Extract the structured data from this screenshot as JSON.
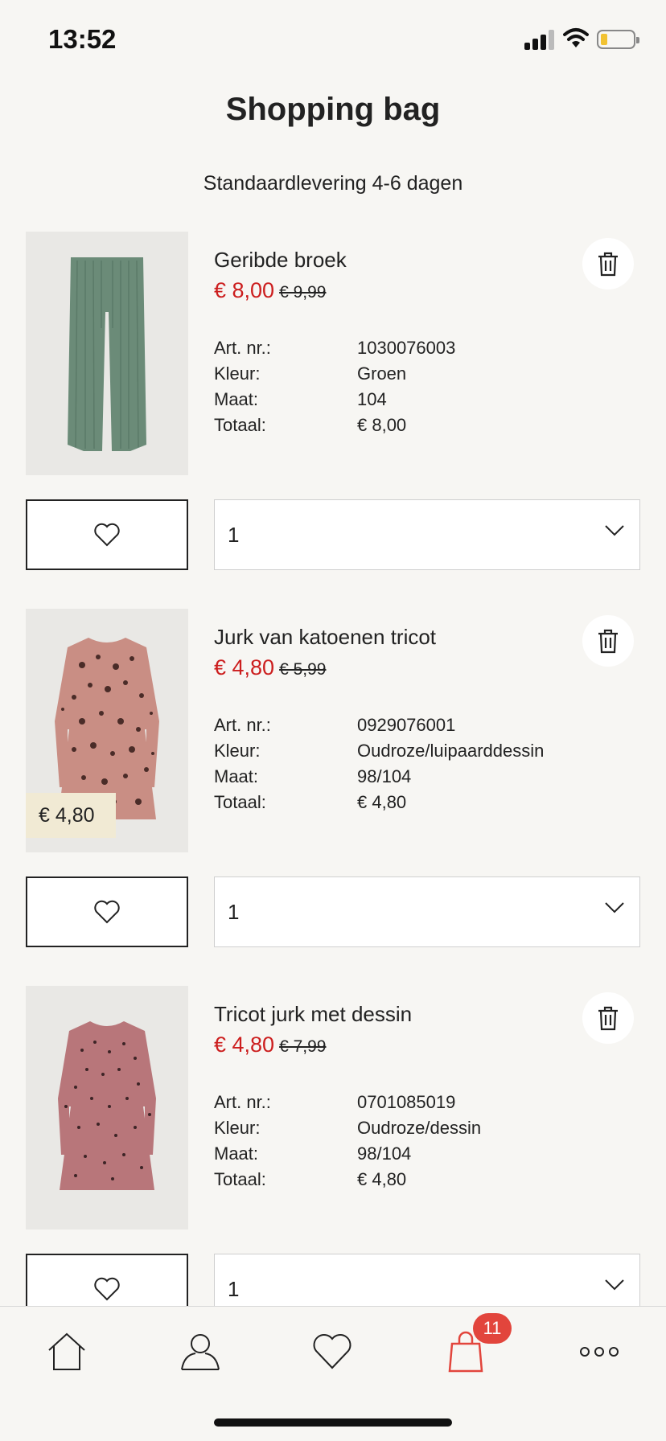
{
  "status_bar": {
    "time": "13:52"
  },
  "header": {
    "title": "Shopping bag",
    "delivery": "Standaardlevering 4-6 dagen"
  },
  "labels": {
    "art": "Art. nr.:",
    "color": "Kleur:",
    "size": "Maat:",
    "total": "Totaal:"
  },
  "items": [
    {
      "name": "Geribde broek",
      "price_sale": "€ 8,00",
      "price_old": "€ 9,99",
      "art_nr": "1030076003",
      "color": "Groen",
      "size": "104",
      "total": "€ 8,00",
      "quantity": "1",
      "image_price_tag": ""
    },
    {
      "name": "Jurk van katoenen tricot",
      "price_sale": "€ 4,80",
      "price_old": "€ 5,99",
      "art_nr": "0929076001",
      "color": "Oudroze/luipaarddessin",
      "size": "98/104",
      "total": "€ 4,80",
      "quantity": "1",
      "image_price_tag": "€ 4,80"
    },
    {
      "name": "Tricot jurk met dessin",
      "price_sale": "€ 4,80",
      "price_old": "€ 7,99",
      "art_nr": "0701085019",
      "color": "Oudroze/dessin",
      "size": "98/104",
      "total": "€ 4,80",
      "quantity": "1",
      "image_price_tag": ""
    }
  ],
  "bottom_nav": {
    "bag_badge": "11"
  },
  "colors": {
    "sale": "#cc1e1e",
    "badge": "#e2453c",
    "nav_active": "#e2453c"
  }
}
